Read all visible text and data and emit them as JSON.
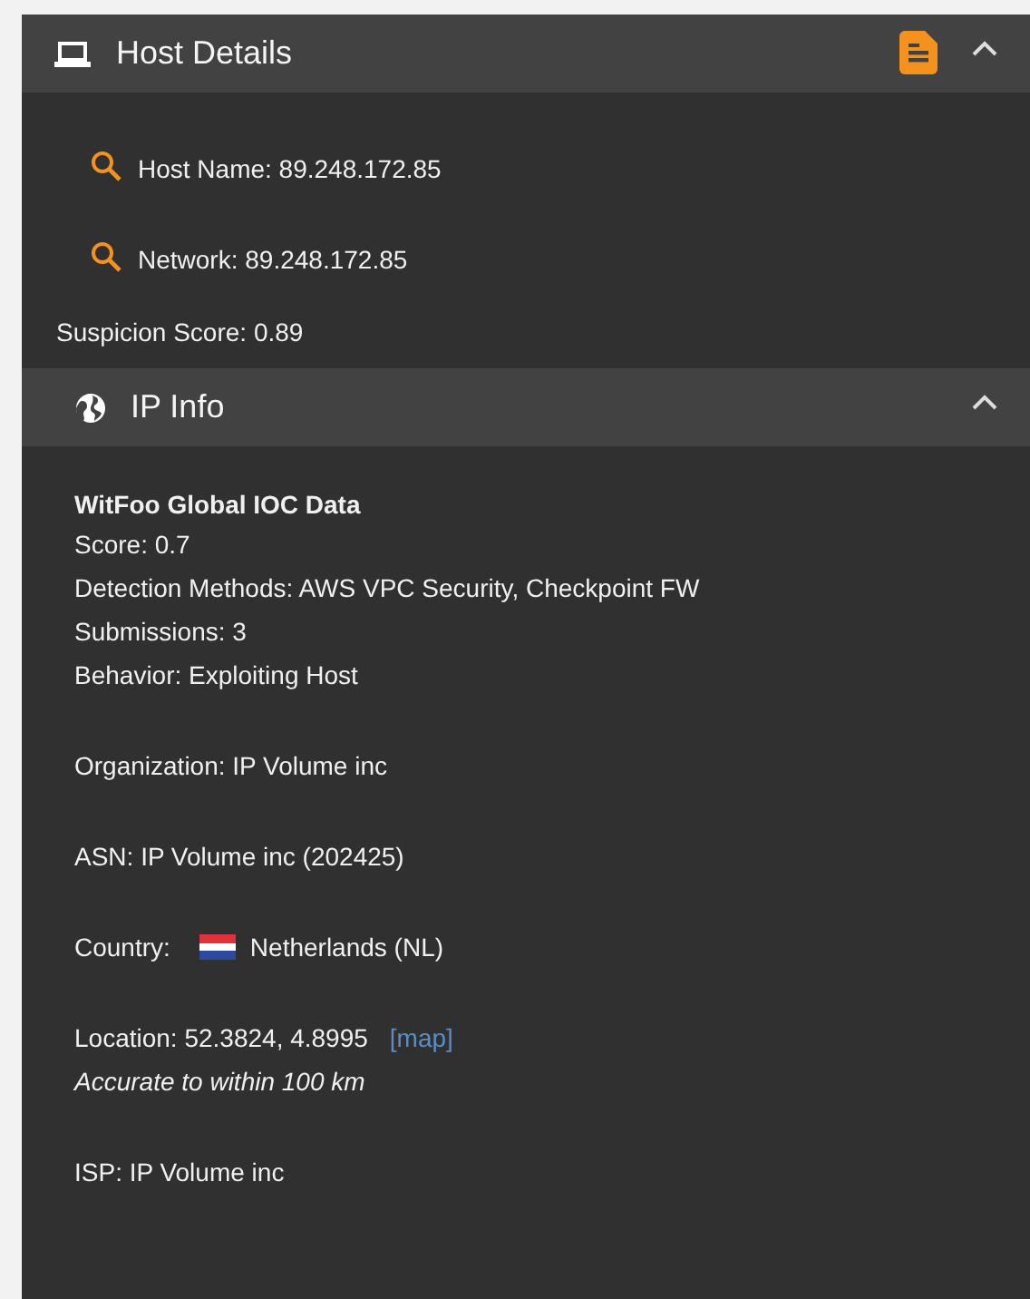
{
  "host_details": {
    "title": "Host Details",
    "expanded": true,
    "lookups": [
      {
        "label": "Host Name: 89.248.172.85"
      },
      {
        "label": "Network: 89.248.172.85"
      }
    ],
    "suspicion_score": "Suspicion Score: 0.89"
  },
  "ip_info": {
    "title": "IP Info",
    "expanded": true,
    "ioc_title": "WitFoo Global IOC Data",
    "ioc_lines": [
      "Score: 0.7",
      "Detection Methods: AWS VPC Security, Checkpoint FW",
      "Submissions: 3",
      "Behavior: Exploiting Host"
    ],
    "organization": "Organization: IP Volume inc",
    "asn": "ASN: IP Volume inc (202425)",
    "country_label": "Country:",
    "country": "Netherlands (NL)",
    "location": "Location: 52.3824, 4.8995",
    "map_link": "[map]",
    "accuracy": "Accurate to within 100 km",
    "isp": "ISP: IP Volume inc"
  }
}
